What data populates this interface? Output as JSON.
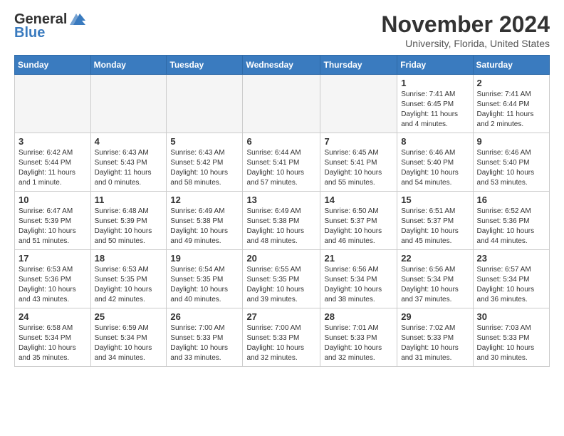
{
  "header": {
    "logo_general": "General",
    "logo_blue": "Blue",
    "month": "November 2024",
    "location": "University, Florida, United States"
  },
  "weekdays": [
    "Sunday",
    "Monday",
    "Tuesday",
    "Wednesday",
    "Thursday",
    "Friday",
    "Saturday"
  ],
  "weeks": [
    [
      {
        "day": "",
        "empty": true
      },
      {
        "day": "",
        "empty": true
      },
      {
        "day": "",
        "empty": true
      },
      {
        "day": "",
        "empty": true
      },
      {
        "day": "",
        "empty": true
      },
      {
        "day": "1",
        "sunrise": "Sunrise: 7:41 AM",
        "sunset": "Sunset: 6:45 PM",
        "daylight": "Daylight: 11 hours and 4 minutes."
      },
      {
        "day": "2",
        "sunrise": "Sunrise: 7:41 AM",
        "sunset": "Sunset: 6:44 PM",
        "daylight": "Daylight: 11 hours and 2 minutes."
      }
    ],
    [
      {
        "day": "3",
        "sunrise": "Sunrise: 6:42 AM",
        "sunset": "Sunset: 5:44 PM",
        "daylight": "Daylight: 11 hours and 1 minute."
      },
      {
        "day": "4",
        "sunrise": "Sunrise: 6:43 AM",
        "sunset": "Sunset: 5:43 PM",
        "daylight": "Daylight: 11 hours and 0 minutes."
      },
      {
        "day": "5",
        "sunrise": "Sunrise: 6:43 AM",
        "sunset": "Sunset: 5:42 PM",
        "daylight": "Daylight: 10 hours and 58 minutes."
      },
      {
        "day": "6",
        "sunrise": "Sunrise: 6:44 AM",
        "sunset": "Sunset: 5:41 PM",
        "daylight": "Daylight: 10 hours and 57 minutes."
      },
      {
        "day": "7",
        "sunrise": "Sunrise: 6:45 AM",
        "sunset": "Sunset: 5:41 PM",
        "daylight": "Daylight: 10 hours and 55 minutes."
      },
      {
        "day": "8",
        "sunrise": "Sunrise: 6:46 AM",
        "sunset": "Sunset: 5:40 PM",
        "daylight": "Daylight: 10 hours and 54 minutes."
      },
      {
        "day": "9",
        "sunrise": "Sunrise: 6:46 AM",
        "sunset": "Sunset: 5:40 PM",
        "daylight": "Daylight: 10 hours and 53 minutes."
      }
    ],
    [
      {
        "day": "10",
        "sunrise": "Sunrise: 6:47 AM",
        "sunset": "Sunset: 5:39 PM",
        "daylight": "Daylight: 10 hours and 51 minutes."
      },
      {
        "day": "11",
        "sunrise": "Sunrise: 6:48 AM",
        "sunset": "Sunset: 5:39 PM",
        "daylight": "Daylight: 10 hours and 50 minutes."
      },
      {
        "day": "12",
        "sunrise": "Sunrise: 6:49 AM",
        "sunset": "Sunset: 5:38 PM",
        "daylight": "Daylight: 10 hours and 49 minutes."
      },
      {
        "day": "13",
        "sunrise": "Sunrise: 6:49 AM",
        "sunset": "Sunset: 5:38 PM",
        "daylight": "Daylight: 10 hours and 48 minutes."
      },
      {
        "day": "14",
        "sunrise": "Sunrise: 6:50 AM",
        "sunset": "Sunset: 5:37 PM",
        "daylight": "Daylight: 10 hours and 46 minutes."
      },
      {
        "day": "15",
        "sunrise": "Sunrise: 6:51 AM",
        "sunset": "Sunset: 5:37 PM",
        "daylight": "Daylight: 10 hours and 45 minutes."
      },
      {
        "day": "16",
        "sunrise": "Sunrise: 6:52 AM",
        "sunset": "Sunset: 5:36 PM",
        "daylight": "Daylight: 10 hours and 44 minutes."
      }
    ],
    [
      {
        "day": "17",
        "sunrise": "Sunrise: 6:53 AM",
        "sunset": "Sunset: 5:36 PM",
        "daylight": "Daylight: 10 hours and 43 minutes."
      },
      {
        "day": "18",
        "sunrise": "Sunrise: 6:53 AM",
        "sunset": "Sunset: 5:35 PM",
        "daylight": "Daylight: 10 hours and 42 minutes."
      },
      {
        "day": "19",
        "sunrise": "Sunrise: 6:54 AM",
        "sunset": "Sunset: 5:35 PM",
        "daylight": "Daylight: 10 hours and 40 minutes."
      },
      {
        "day": "20",
        "sunrise": "Sunrise: 6:55 AM",
        "sunset": "Sunset: 5:35 PM",
        "daylight": "Daylight: 10 hours and 39 minutes."
      },
      {
        "day": "21",
        "sunrise": "Sunrise: 6:56 AM",
        "sunset": "Sunset: 5:34 PM",
        "daylight": "Daylight: 10 hours and 38 minutes."
      },
      {
        "day": "22",
        "sunrise": "Sunrise: 6:56 AM",
        "sunset": "Sunset: 5:34 PM",
        "daylight": "Daylight: 10 hours and 37 minutes."
      },
      {
        "day": "23",
        "sunrise": "Sunrise: 6:57 AM",
        "sunset": "Sunset: 5:34 PM",
        "daylight": "Daylight: 10 hours and 36 minutes."
      }
    ],
    [
      {
        "day": "24",
        "sunrise": "Sunrise: 6:58 AM",
        "sunset": "Sunset: 5:34 PM",
        "daylight": "Daylight: 10 hours and 35 minutes."
      },
      {
        "day": "25",
        "sunrise": "Sunrise: 6:59 AM",
        "sunset": "Sunset: 5:34 PM",
        "daylight": "Daylight: 10 hours and 34 minutes."
      },
      {
        "day": "26",
        "sunrise": "Sunrise: 7:00 AM",
        "sunset": "Sunset: 5:33 PM",
        "daylight": "Daylight: 10 hours and 33 minutes."
      },
      {
        "day": "27",
        "sunrise": "Sunrise: 7:00 AM",
        "sunset": "Sunset: 5:33 PM",
        "daylight": "Daylight: 10 hours and 32 minutes."
      },
      {
        "day": "28",
        "sunrise": "Sunrise: 7:01 AM",
        "sunset": "Sunset: 5:33 PM",
        "daylight": "Daylight: 10 hours and 32 minutes."
      },
      {
        "day": "29",
        "sunrise": "Sunrise: 7:02 AM",
        "sunset": "Sunset: 5:33 PM",
        "daylight": "Daylight: 10 hours and 31 minutes."
      },
      {
        "day": "30",
        "sunrise": "Sunrise: 7:03 AM",
        "sunset": "Sunset: 5:33 PM",
        "daylight": "Daylight: 10 hours and 30 minutes."
      }
    ]
  ]
}
